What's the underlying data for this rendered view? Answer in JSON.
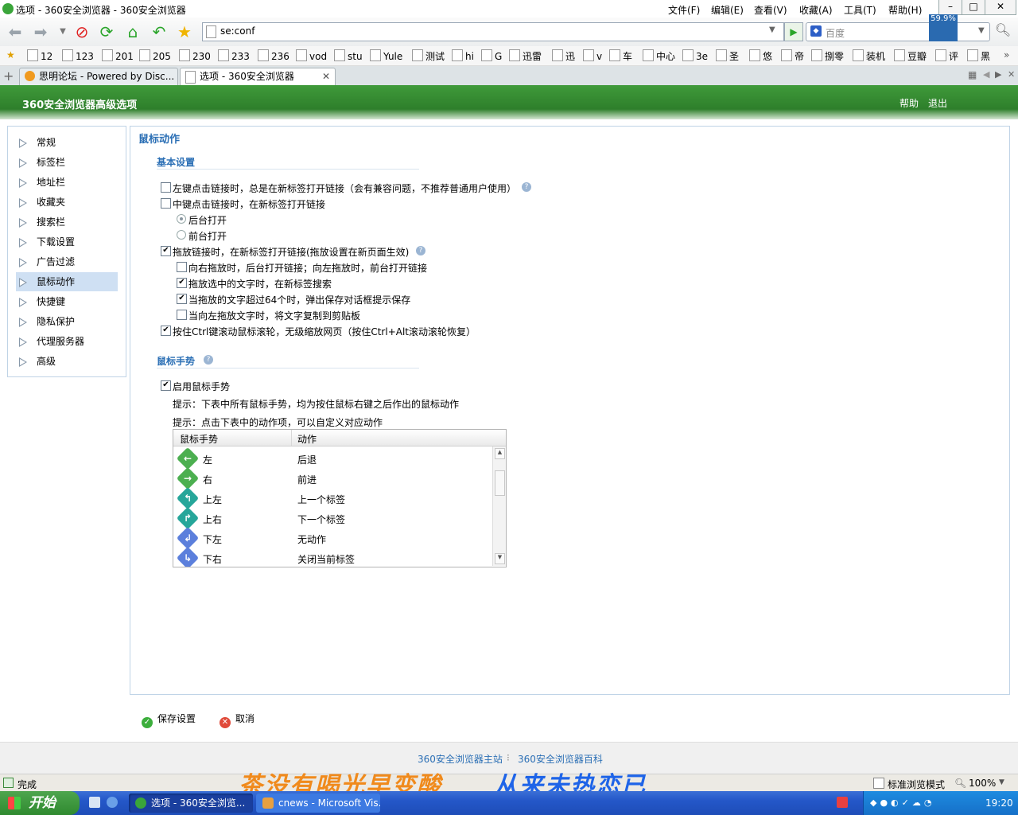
{
  "window": {
    "title": "选项 - 360安全浏览器 - 360安全浏览器"
  },
  "menu": [
    "文件(F)",
    "编辑(E)",
    "查看(V)",
    "收藏(A)",
    "工具(T)",
    "帮助(H)"
  ],
  "address": {
    "value": "se:conf"
  },
  "search": {
    "placeholder": "百度"
  },
  "cpu": {
    "value": "59.9%"
  },
  "bookmarks": [
    "12",
    "123",
    "201",
    "205",
    "230",
    "233",
    "236",
    "vod",
    "stu",
    "Yule",
    "测试",
    "hi",
    "G",
    "迅雷",
    "迅",
    "v",
    "车",
    "中心",
    "3e",
    "圣",
    "悠",
    "帝",
    "捌零",
    "装机",
    "豆瓣",
    "评",
    "黑"
  ],
  "tabs": [
    {
      "label": "思明论坛 - Powered by Disc...",
      "active": false
    },
    {
      "label": "选项 - 360安全浏览器",
      "active": true
    }
  ],
  "header": {
    "title": "360安全浏览器高级选项",
    "help": "帮助",
    "exit": "退出"
  },
  "sidebar": {
    "items": [
      "常规",
      "标签栏",
      "地址栏",
      "收藏夹",
      "搜索栏",
      "下载设置",
      "广告过滤",
      "鼠标动作",
      "快捷键",
      "隐私保护",
      "代理服务器",
      "高级"
    ],
    "active_index": 7
  },
  "main": {
    "section_title": "鼠标动作",
    "basic": {
      "title": "基本设置",
      "left_click_newtab": {
        "label": "左键点击链接时，总是在新标签打开链接（会有兼容问题，不推荐普通用户使用）",
        "checked": false
      },
      "middle_click_newtab": {
        "label": "中键点击链接时，在新标签打开链接",
        "checked": false
      },
      "bg_open": {
        "label": "后台打开",
        "selected": true
      },
      "fg_open": {
        "label": "前台打开",
        "selected": false
      },
      "drag_link": {
        "label": "拖放链接时，在新标签打开链接(拖放设置在新页面生效)",
        "checked": true
      },
      "drag_right_left": {
        "label": "向右拖放时，后台打开链接；向左拖放时，前台打开链接",
        "checked": false
      },
      "drag_text_search": {
        "label": "拖放选中的文字时，在新标签搜索",
        "checked": true
      },
      "drag_text_save": {
        "label": "当拖放的文字超过64个时，弹出保存对话框提示保存",
        "checked": true
      },
      "drag_left_copy": {
        "label": "当向左拖放文字时，将文字复制到剪贴板",
        "checked": false
      },
      "ctrl_wheel_zoom": {
        "label": "按住Ctrl键滚动鼠标滚轮，无级缩放网页（按住Ctrl+Alt滚动滚轮恢复）",
        "checked": true
      }
    },
    "gesture": {
      "title": "鼠标手势",
      "enable": {
        "label": "启用鼠标手势",
        "checked": true
      },
      "tip1": "提示：下表中所有鼠标手势，均为按住鼠标右键之后作出的鼠标动作",
      "tip2": "提示：点击下表中的动作项，可以自定义对应动作",
      "columns": [
        "鼠标手势",
        "动作"
      ],
      "rows": [
        {
          "gesture": "左",
          "action": "后退",
          "icon": "arrow-left-icon",
          "color": "#4caf50",
          "glyph": "←"
        },
        {
          "gesture": "右",
          "action": "前进",
          "icon": "arrow-right-icon",
          "color": "#4caf50",
          "glyph": "→"
        },
        {
          "gesture": "上左",
          "action": "上一个标签",
          "icon": "arrow-up-left-icon",
          "color": "#26a69a",
          "glyph": "↰"
        },
        {
          "gesture": "上右",
          "action": "下一个标签",
          "icon": "arrow-up-right-icon",
          "color": "#26a69a",
          "glyph": "↱"
        },
        {
          "gesture": "下左",
          "action": "无动作",
          "icon": "arrow-down-left-icon",
          "color": "#5b7fdc",
          "glyph": "↲"
        },
        {
          "gesture": "下右",
          "action": "关闭当前标签",
          "icon": "arrow-down-right-icon",
          "color": "#5b7fdc",
          "glyph": "↳"
        }
      ]
    }
  },
  "buttons": {
    "save": "保存设置",
    "cancel": "取消"
  },
  "footer": {
    "link1": "360安全浏览器主站",
    "sep": "⁝",
    "link2": "360安全浏览器百科"
  },
  "status": {
    "text": "完成",
    "mode": "标准浏览模式",
    "zoom": "100%"
  },
  "banner": {
    "part1": "茶没有喝光早变酸",
    "part2": "从来未热恋已",
    "color1": "#f08a1c",
    "color2": "#1e64e8"
  },
  "taskbar": {
    "start": "开始",
    "tasks": [
      "选项 - 360安全浏览...",
      "cnews - Microsoft Vis..."
    ],
    "clock": "19:20"
  }
}
